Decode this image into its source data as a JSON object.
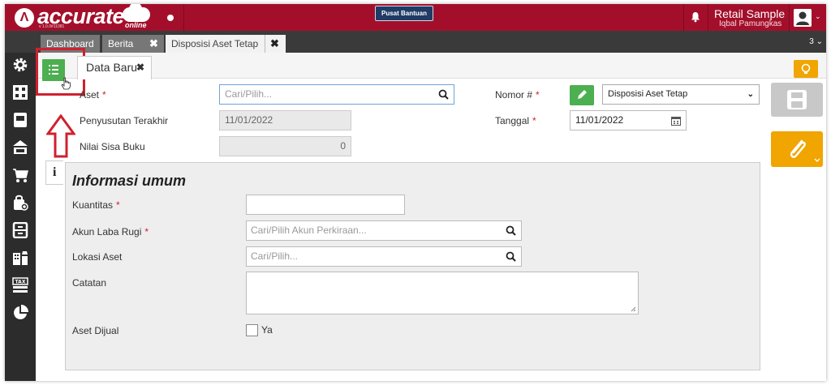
{
  "header": {
    "logo_text": "accurate",
    "logo_sub": "online",
    "version": "v 1.0.0#11081",
    "help_label": "Pusat Bantuan",
    "user_name": "Retail Sample",
    "user_sub": "Iqbal Pamungkas"
  },
  "tabs": [
    {
      "label": "Dashboard"
    },
    {
      "label": "Berita"
    },
    {
      "label": "Disposisi Aset Tetap"
    }
  ],
  "tab_close": "✖",
  "tab_count": "3",
  "subtab": {
    "label": "Data Baru",
    "close": "✖"
  },
  "form": {
    "aset_label": "Aset",
    "aset_placeholder": "Cari/Pilih...",
    "penyusutan_label": "Penyusutan Terakhir",
    "penyusutan_value": "11/01/2022",
    "nilai_label": "Nilai Sisa Buku",
    "nilai_value": "0",
    "nomor_label": "Nomor #",
    "nomor_value": "Disposisi Aset Tetap",
    "tanggal_label": "Tanggal",
    "tanggal_value": "11/01/2022",
    "required_mark": "*"
  },
  "info": {
    "icon": "i",
    "title": "Informasi umum",
    "kuantitas_label": "Kuantitas",
    "akun_label": "Akun Laba Rugi",
    "akun_placeholder": "Cari/Pilih Akun Perkiraan...",
    "lokasi_label": "Lokasi Aset",
    "lokasi_placeholder": "Cari/Pilih...",
    "catatan_label": "Catatan",
    "dijual_label": "Aset Dijual",
    "dijual_option": "Ya"
  },
  "colors": {
    "brand": "#a30f2b",
    "sidebar": "#2c2c2c",
    "green": "#4caf50",
    "orange": "#f0a500",
    "highlight": "#d0202e"
  }
}
